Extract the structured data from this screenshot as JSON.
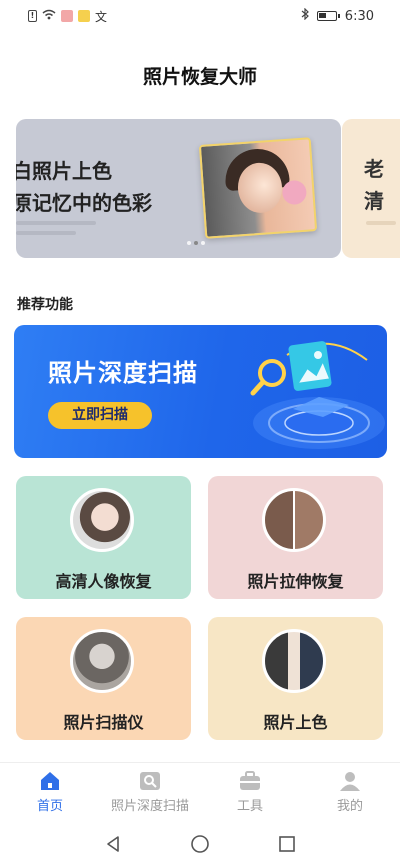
{
  "status_bar": {
    "time": "6:30",
    "ime_label": "文"
  },
  "app": {
    "title": "照片恢复大师"
  },
  "banner": {
    "line1": "白照片上色",
    "line2": "原记忆中的色彩",
    "next_line1": "老",
    "next_line2": "清",
    "dot_count": 3,
    "active_dot": 2
  },
  "section": {
    "title": "推荐功能"
  },
  "scan_card": {
    "title": "照片深度扫描",
    "button": "立即扫描"
  },
  "features": [
    {
      "label": "高清人像恢复"
    },
    {
      "label": "照片拉伸恢复"
    },
    {
      "label": "照片扫描仪"
    },
    {
      "label": "照片上色"
    }
  ],
  "nav": {
    "items": [
      {
        "label": "首页",
        "icon": "home-icon",
        "active": true
      },
      {
        "label": "照片深度扫描",
        "icon": "photo-scan-icon",
        "active": false
      },
      {
        "label": "工具",
        "icon": "briefcase-icon",
        "active": false
      },
      {
        "label": "我的",
        "icon": "person-icon",
        "active": false
      }
    ]
  },
  "colors": {
    "accent": "#2f6fe8",
    "scan_button": "#f6c22b",
    "card_green": "#b9e4d5",
    "card_pink": "#f1d6d6",
    "card_orange": "#fbd7b4",
    "card_cream": "#f7e6c5"
  }
}
